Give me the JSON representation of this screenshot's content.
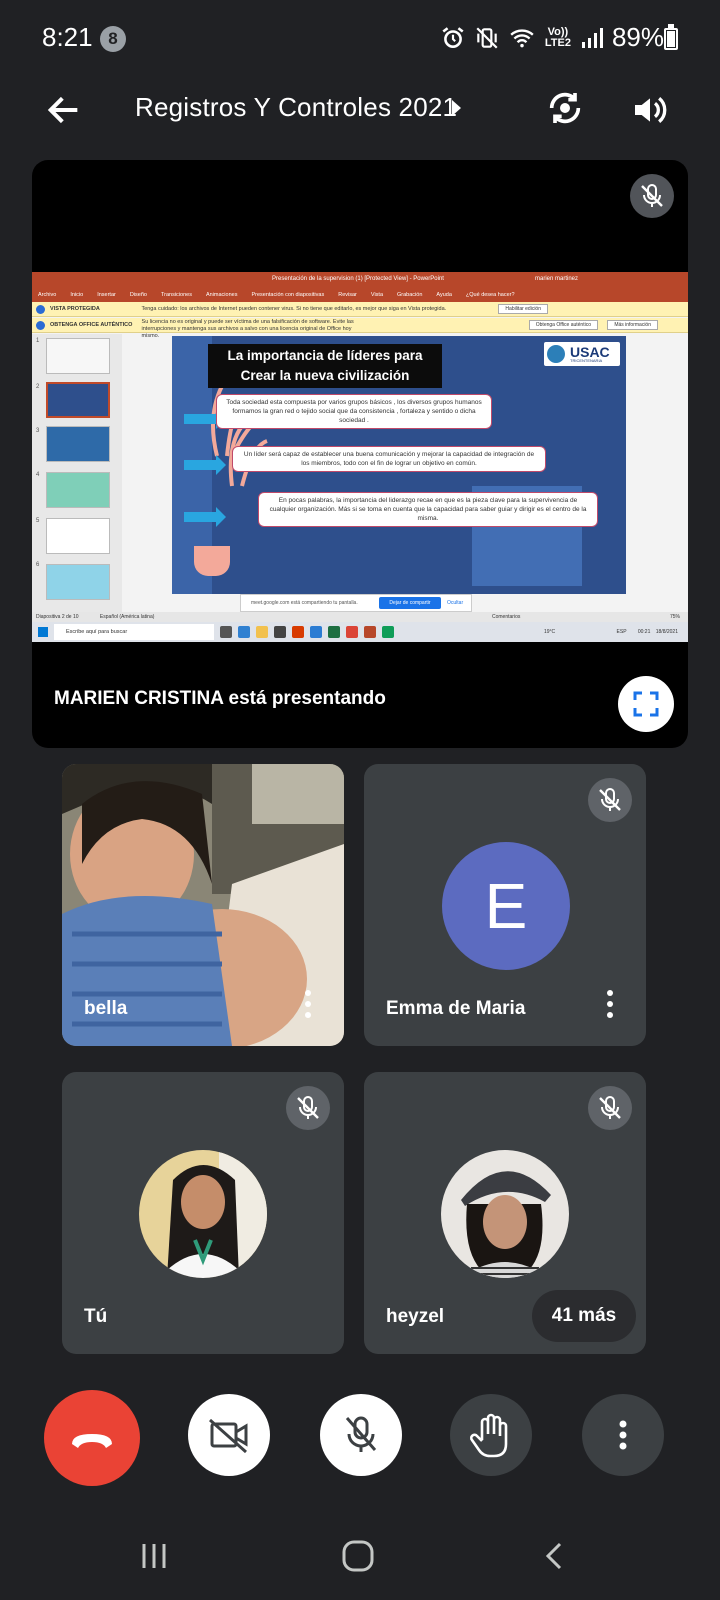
{
  "status": {
    "time": "8:21",
    "notif_count": "8",
    "network": "Vo)) LTE2",
    "battery": "89%",
    "battery_level": 0.89
  },
  "header": {
    "title": "Registros Y Controles 2021"
  },
  "presentation": {
    "presenter_text": "MARIEN CRISTINA está presentando",
    "screen": {
      "window_title": "Presentación de la supervision (1) [Protected View] - PowerPoint",
      "window_user": "marien martinez",
      "menu": [
        "Archivo",
        "Inicio",
        "Insertar",
        "Diseño",
        "Transiciones",
        "Animaciones",
        "Presentación con diapositivas",
        "Revisar",
        "Vista",
        "Grabación",
        "Ayuda",
        "¿Qué desea hacer?"
      ],
      "protected_bar": {
        "label": "VISTA PROTEGIDA",
        "text": "Tenga cuidado: los archivos de Internet pueden contener virus. Si no tiene que editarlo, es mejor que siga en Vista protegida.",
        "button": "Habilitar edición"
      },
      "office_bar": {
        "label": "OBTENGA OFFICE AUTÉNTICO",
        "text": "Su licencia no es original y puede ser víctima de una falsificación de software. Evite las interrupciones y mantenga sus archivos a salvo con una licencia original de Office hoy mismo.",
        "button1": "Obtenga Office auténtico",
        "button2": "Más información"
      },
      "slide": {
        "title_line1": "La importancia de líderes para",
        "title_line2": "Crear la nueva civilización",
        "logo": "USAC",
        "logo_sub": "TRICENTENARIA",
        "box1": "Toda sociedad esta compuesta por varios grupos básicos , los diversos grupos humanos formamos la gran red o tejido social que da consistencia , fortaleza y sentido o dicha sociedad .",
        "box2": "Un líder será capaz de establecer una buena comunicación y mejorar la capacidad de integración de los miembros, todo con el fin de lograr un objetivo en común.",
        "box3": "En pocas palabras, la importancia del liderazgo recae en que es la pieza clave para la supervivencia de cualquier organización. Más si se toma en cuenta que la capacidad para saber guiar y dirigir es el centro de la misma."
      },
      "thumb_numbers": [
        "1",
        "2",
        "3",
        "4",
        "5",
        "6"
      ],
      "share_text": "meet.google.com está compartiendo tu pantalla.",
      "share_stop": "Dejar de compartir",
      "share_hide": "Ocultar",
      "status_left": "Diapositiva 2 de 10",
      "status_lang": "Español (América latina)",
      "status_notes": "Comentarios",
      "status_zoom": "75%",
      "taskbar_search": "Escribe aquí para buscar",
      "tray_temp": "19°C",
      "tray_lang": "ESP",
      "tray_time": "00:21",
      "tray_date": "18/8/2021"
    }
  },
  "participants": [
    {
      "name": "bella",
      "muted": false
    },
    {
      "name": "Emma de Maria",
      "initial": "E",
      "muted": true
    },
    {
      "name": "Tú",
      "muted": true
    },
    {
      "name": "heyzel",
      "muted": true
    }
  ],
  "more_label": "41 más",
  "colors": {
    "background": "#202124",
    "tile": "#3c4043",
    "end_call": "#ea4335",
    "avatar": "#5c6bc0",
    "accent": "#1a73e8"
  },
  "icons": [
    "back-arrow-icon",
    "camera-switch-icon",
    "speaker-icon",
    "mic-off-icon",
    "fullscreen-icon",
    "more-vert-icon",
    "end-call-icon",
    "camera-off-icon",
    "raise-hand-icon",
    "recents-icon",
    "home-icon",
    "nav-back-icon"
  ]
}
